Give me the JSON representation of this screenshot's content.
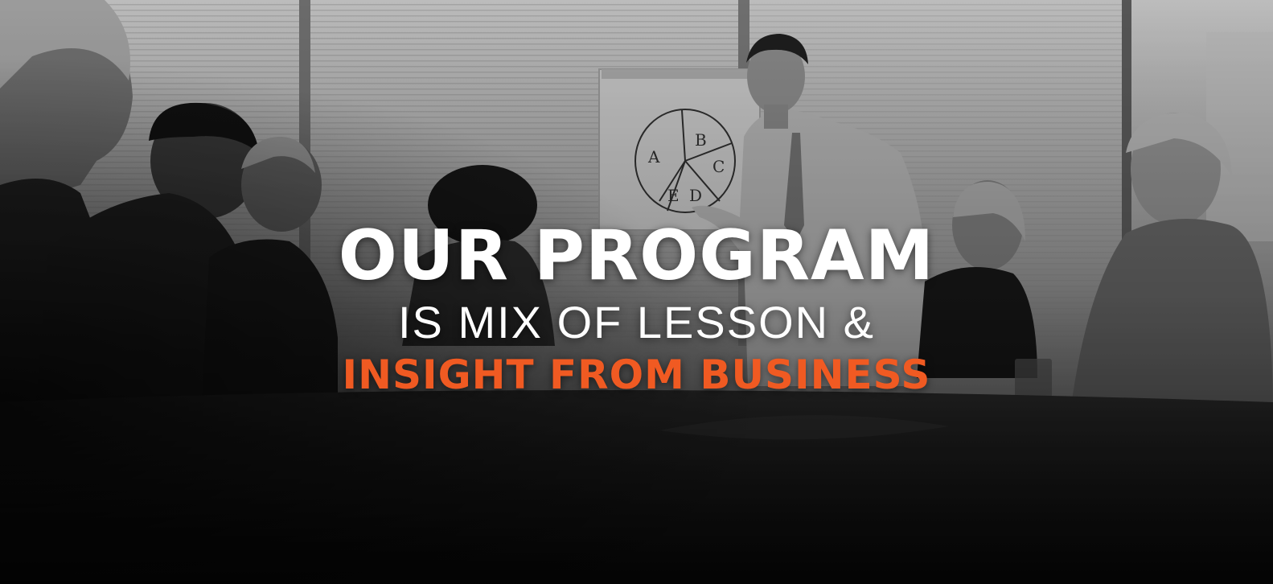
{
  "banner": {
    "headline_line1": "OUR PROGRAM",
    "headline_line2": "IS MIX OF LESSON &",
    "headline_line3": "INSIGHT FROM BUSINESS"
  },
  "photo": {
    "flipchart_labels": [
      "A",
      "B",
      "C",
      "D",
      "E"
    ]
  },
  "colors": {
    "headline_primary": "#ffffff",
    "headline_accent": "#f05a22",
    "photo_tone": "grayscale"
  }
}
